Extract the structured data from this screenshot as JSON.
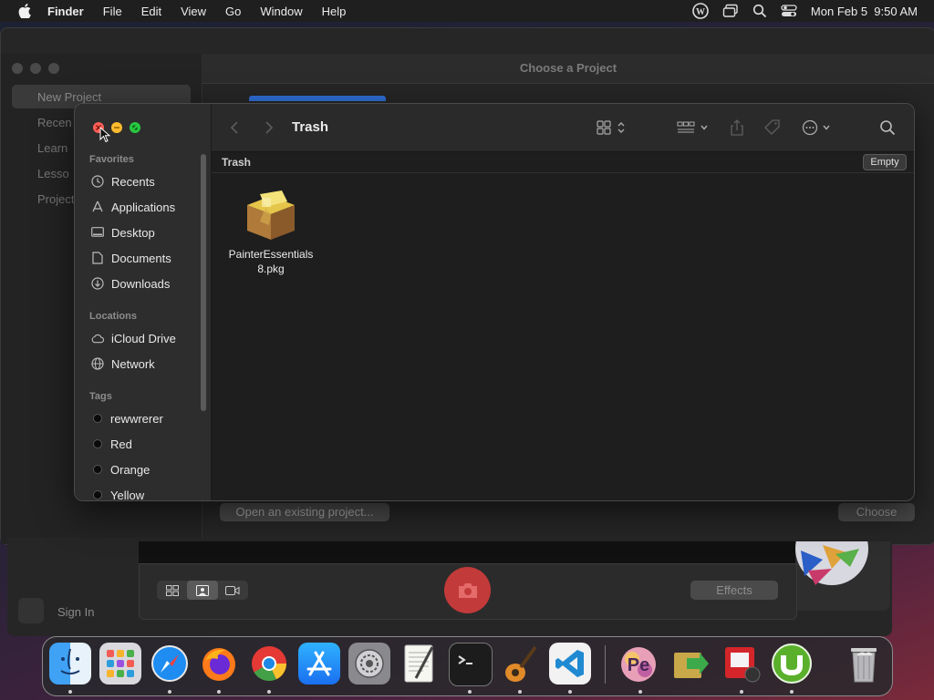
{
  "menubar": {
    "app": "Finder",
    "items": [
      "File",
      "Edit",
      "View",
      "Go",
      "Window",
      "Help"
    ],
    "clock": "Mon Feb 5  9:50 AM"
  },
  "background_window": {
    "title": "Choose a Project",
    "sidebar": [
      "New Project",
      "Recen",
      "Learn",
      "Lesso",
      "Project"
    ],
    "open_existing_label": "Open an existing project...",
    "choose_label": "Choose"
  },
  "camera_window": {
    "effects_label": "Effects",
    "signin_label": "Sign In"
  },
  "finder": {
    "title": "Trash",
    "path_label": "Trash",
    "empty_label": "Empty",
    "sections": {
      "favorites": "Favorites",
      "locations": "Locations",
      "tags": "Tags"
    },
    "favorites": [
      {
        "label": "Recents",
        "icon": "clock-icon"
      },
      {
        "label": "Applications",
        "icon": "applications-icon"
      },
      {
        "label": "Desktop",
        "icon": "desktop-icon"
      },
      {
        "label": "Documents",
        "icon": "document-icon"
      },
      {
        "label": "Downloads",
        "icon": "download-icon"
      }
    ],
    "locations": [
      {
        "label": "iCloud Drive",
        "icon": "cloud-icon"
      },
      {
        "label": "Network",
        "icon": "globe-icon"
      }
    ],
    "tags": [
      "rewwrerer",
      "Red",
      "Orange",
      "Yellow"
    ],
    "files": [
      {
        "name_line1": "PainterEssentials",
        "name_line2": "8.pkg",
        "icon": "package-icon"
      }
    ]
  },
  "dock": {
    "apps": [
      "Finder",
      "Launchpad",
      "Safari",
      "Firefox",
      "Chrome",
      "App Store",
      "System Settings",
      "TextEdit",
      "Terminal",
      "GarageBand",
      "Visual Studio Code",
      "Painter Essentials",
      "Migration",
      "Photo Booth",
      "uTorrent",
      "Trash"
    ]
  },
  "colors": {
    "close": "#fe5f57",
    "minimize": "#febc2e",
    "maximize": "#28c840",
    "shutter": "#c23a3a"
  }
}
